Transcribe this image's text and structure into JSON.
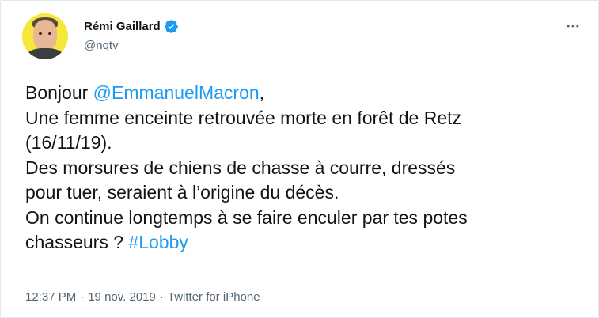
{
  "author": {
    "display_name": "Rémi Gaillard",
    "handle": "@nqtv",
    "verified": true,
    "avatar_bg": "#f5e83a"
  },
  "tweet": {
    "line1_prefix": "Bonjour ",
    "line1_mention": "@EmmanuelMacron",
    "line1_suffix": ",",
    "line2": "Une femme enceinte retrouvée morte en forêt de Retz",
    "line3": "(16/11/19).",
    "line4": "Des morsures de chiens de chasse à courre, dressés",
    "line5": "pour tuer, seraient à l’origine du décès.",
    "line6": "On continue longtemps à se faire enculer par tes potes",
    "line7_prefix": "chasseurs ? ",
    "line7_hashtag": "#Lobby"
  },
  "meta": {
    "time": "12:37 PM",
    "separator": "·",
    "date": "19 nov. 2019",
    "separator2": "·",
    "source": "Twitter for iPhone"
  },
  "colors": {
    "link": "#1d9bf0",
    "secondary_text": "#536471",
    "verified_badge": "#1d9bf0"
  },
  "icons": {
    "verified": "verified-badge-icon",
    "more": "more-options-icon"
  }
}
